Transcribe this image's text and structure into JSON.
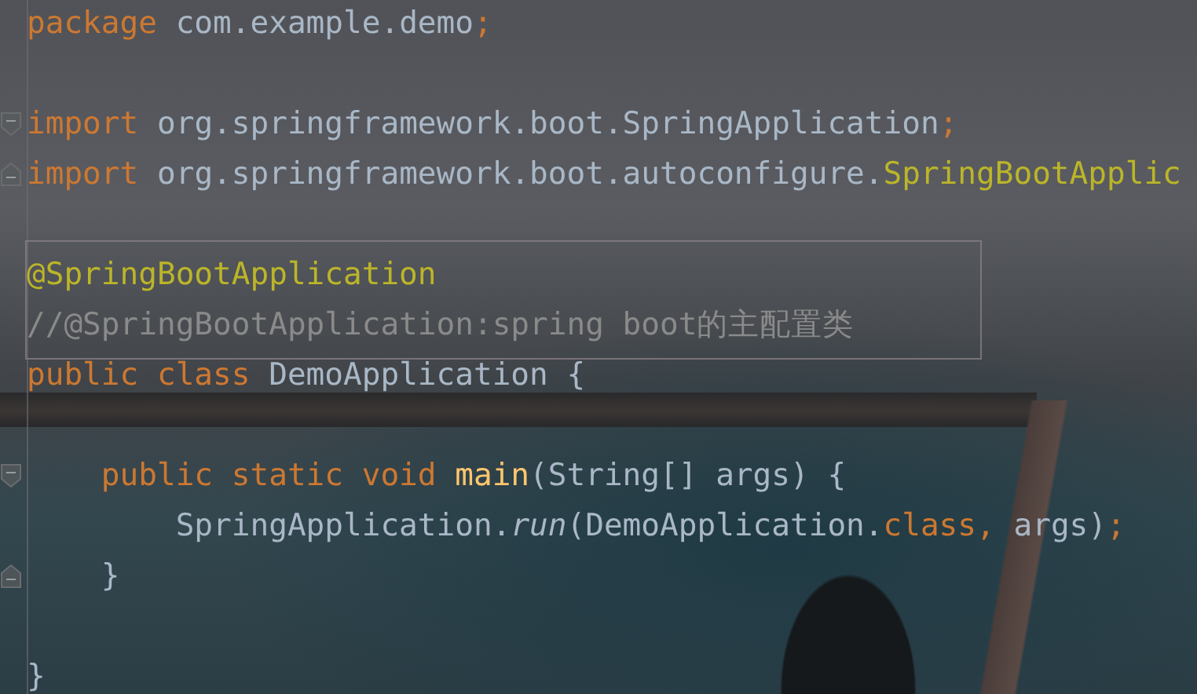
{
  "editor": {
    "blocks": [
      {
        "boxed": false,
        "lines": [
          {
            "tokens": [
              {
                "kind": "keyword",
                "text": "package "
              },
              {
                "kind": "plain",
                "text": "com.example.demo"
              },
              {
                "kind": "keyword",
                "text": ";"
              }
            ]
          },
          {
            "gap_before": true,
            "fold_start": true,
            "tokens": [
              {
                "kind": "keyword",
                "text": "import "
              },
              {
                "kind": "plain",
                "text": "org.springframework.boot.SpringApplication"
              },
              {
                "kind": "keyword",
                "text": ";"
              }
            ]
          },
          {
            "fold_end": true,
            "tokens": [
              {
                "kind": "keyword",
                "text": "import "
              },
              {
                "kind": "plain",
                "text": "org.springframework.boot.autoconfigure."
              },
              {
                "kind": "annotation",
                "text": "SpringBootApplic"
              }
            ]
          }
        ]
      },
      {
        "boxed": true,
        "gap_before": true,
        "lines": [
          {
            "tokens": [
              {
                "kind": "annotation",
                "text": "@SpringBootApplication"
              }
            ]
          },
          {
            "tokens": [
              {
                "kind": "comment",
                "text": "//@SpringBootApplication:spring boot的主配置类"
              }
            ]
          }
        ]
      },
      {
        "boxed": false,
        "lines": [
          {
            "tokens": [
              {
                "kind": "keyword",
                "text": "public class "
              },
              {
                "kind": "plain",
                "text": "DemoApplication {"
              }
            ]
          },
          {
            "gap_before": true,
            "fold_start": true,
            "tokens": [
              {
                "kind": "keyword",
                "text": "    public static void "
              },
              {
                "kind": "method",
                "text": "main"
              },
              {
                "kind": "plain",
                "text": "(String[] args) {"
              }
            ]
          },
          {
            "tokens": [
              {
                "kind": "plain",
                "text": "        SpringApplication."
              },
              {
                "kind": "static-call",
                "text": "run"
              },
              {
                "kind": "plain",
                "text": "(DemoApplication."
              },
              {
                "kind": "keyword",
                "text": "class, "
              },
              {
                "kind": "plain",
                "text": "args)"
              },
              {
                "kind": "keyword",
                "text": ";"
              }
            ]
          },
          {
            "fold_end": true,
            "tokens": [
              {
                "kind": "plain",
                "text": "    }"
              }
            ]
          },
          {
            "gap_before": true,
            "tokens": [
              {
                "kind": "plain",
                "text": "}"
              }
            ]
          }
        ]
      }
    ]
  }
}
